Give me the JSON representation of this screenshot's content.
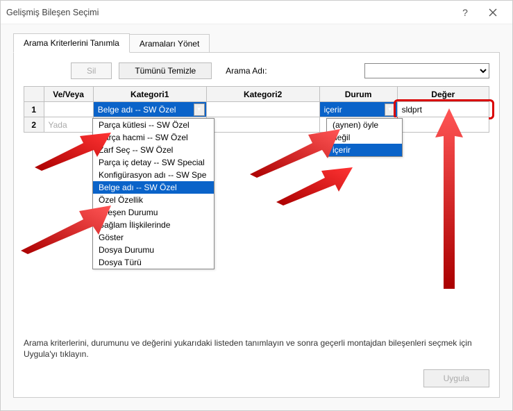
{
  "window": {
    "title": "Gelişmiş Bileşen Seçimi"
  },
  "tabs": {
    "define": "Arama Kriterlerini Tanımla",
    "manage": "Aramaları Yönet"
  },
  "toolbar": {
    "delete": "Sil",
    "clear_all": "Tümünü Temizle",
    "search_name_label": "Arama Adı:"
  },
  "table": {
    "headers": {
      "and_or": "Ve/Veya",
      "category1": "Kategori1",
      "category2": "Kategori2",
      "status": "Durum",
      "value": "Değer"
    },
    "rows": [
      {
        "num": "1",
        "and_or": "",
        "category1": "Belge adı -- SW Özel",
        "status": "içerir",
        "value": "sldprt"
      },
      {
        "num": "2",
        "and_or": "Yada",
        "category1": "",
        "status": "",
        "value": ""
      }
    ]
  },
  "category_dropdown": {
    "items": [
      "Parça kütlesi -- SW Özel",
      "Parça hacmi -- SW Özel",
      "Zarf Seç -- SW Özel",
      "Parça iç detay -- SW Special",
      "Konfigürasyon adı -- SW Spe",
      "Belge adı -- SW Özel",
      "Özel Özellik",
      "Bileşen Durumu",
      "Bağlam İlişkilerinde",
      "Göster",
      "Dosya Durumu",
      "Dosya Türü"
    ],
    "highlight_index": 5
  },
  "status_dropdown": {
    "items": [
      "(aynen) öyle",
      "değil",
      "içerir"
    ],
    "highlight_index": 2
  },
  "help_text": "Arama kriterlerini, durumunu ve değerini yukarıdaki listeden tanımlayın ve sonra geçerli montajdan bileşenleri seçmek için Uygula'yı tıklayın.",
  "buttons": {
    "apply": "Uygula"
  }
}
